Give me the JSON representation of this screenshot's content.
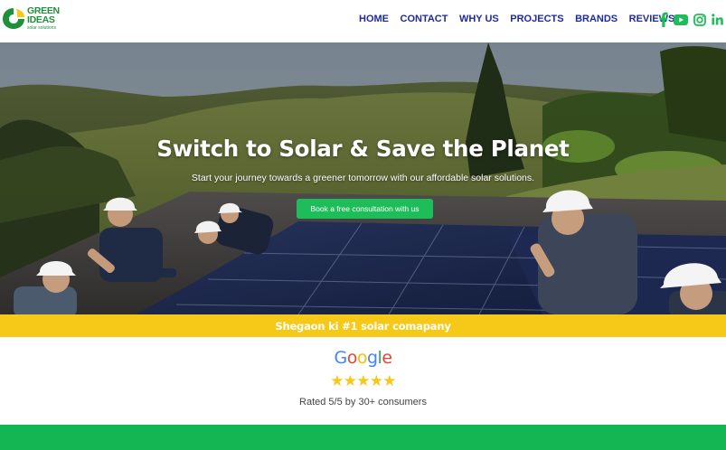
{
  "brand": {
    "line1": "GREEN",
    "line2": "IDEAS",
    "tagline": "solar solutions",
    "color": "#1e8f3a"
  },
  "nav": {
    "items": [
      "HOME",
      "CONTACT",
      "WHY US",
      "PROJECTS",
      "BRANDS",
      "REVIEWS"
    ],
    "color": "#1f2b9e"
  },
  "social": {
    "icons": [
      "facebook-icon",
      "youtube-icon",
      "instagram-icon",
      "linkedin-icon"
    ],
    "color": "#1fbd5a"
  },
  "hero": {
    "title": "Switch to Solar & Save the Planet",
    "subtitle": "Start your journey towards a greener tomorrow with our affordable solar solutions.",
    "cta_label": "Book a free consultation with us",
    "cta_color": "#1fbd5a"
  },
  "banner": {
    "text": "Shegaon ki #1 solar comapany",
    "color": "#f6c818"
  },
  "rating": {
    "provider": "Google",
    "stars": 5,
    "max_stars": 5,
    "text": "Rated 5/5 by 30+ consumers"
  }
}
